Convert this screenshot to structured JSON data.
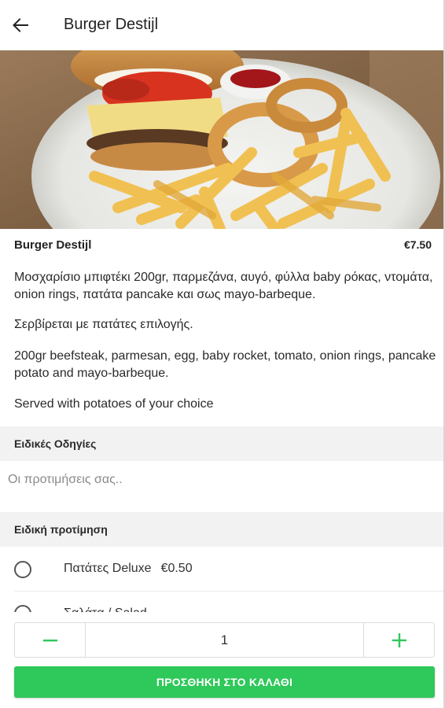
{
  "header": {
    "title": "Burger Destijl",
    "back_icon": "arrow-left-icon"
  },
  "product": {
    "name": "Burger Destijl",
    "price": "€7.50",
    "description_gr": "Μοσχαρίσιο μπιφτέκι 200gr, παρμεζάνα, αυγό, φύλλα baby ρόκας, ντομάτα, onion rings, πατάτα pancake και σως mayo-barbeque.",
    "served_gr": "Σερβίρεται με πατάτες επιλογής.",
    "description_en": "200gr beefsteak, parmesan, egg, baby rocket, tomato, onion rings, pancake potato and mayo-barbeque.",
    "served_en": "Served with potatoes of your choice"
  },
  "special_instructions": {
    "title": "Ειδικές Οδηγίες",
    "placeholder": "Οι προτιμήσεις σας..",
    "value": ""
  },
  "preference": {
    "title": "Ειδική προτίμηση",
    "options": [
      {
        "label": "Πατάτες Deluxe",
        "price": "€0.50",
        "selected": false
      },
      {
        "label": "Σαλάτα / Salad",
        "price": "",
        "selected": false
      }
    ]
  },
  "quantity": {
    "minus_label": "−",
    "value": "1",
    "plus_label": "+"
  },
  "cta": {
    "label": "ΠΡΟΣΘΗΚΗ ΣΤΟ ΚΑΛΑΘΙ"
  },
  "colors": {
    "accent": "#2fc85a",
    "section_bg": "#f2f2f2"
  }
}
